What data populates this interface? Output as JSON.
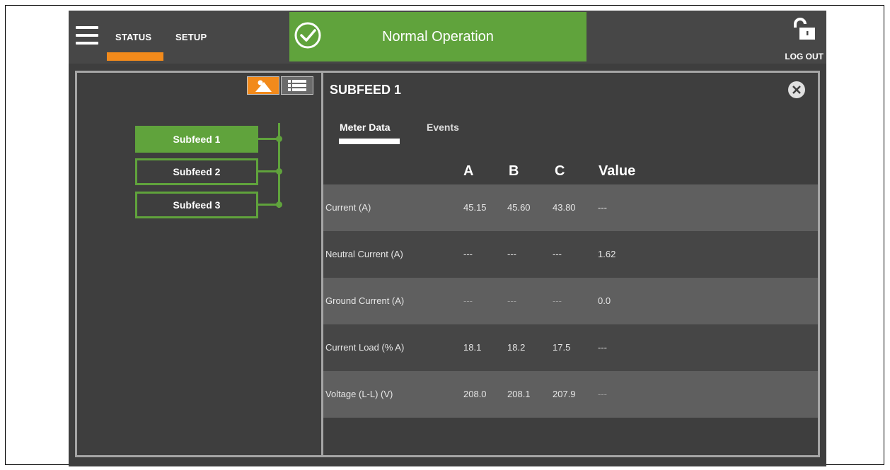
{
  "topbar": {
    "nav": [
      "STATUS",
      "SETUP"
    ],
    "status_text": "Normal Operation",
    "status_icon": "check-circle-icon",
    "logout_label": "LOG OUT",
    "lock_icon": "unlocked-padlock-icon"
  },
  "feeds": [
    "Subfeed 1",
    "Subfeed 2",
    "Subfeed 3"
  ],
  "detail": {
    "title": "SUBFEED 1",
    "tabs": [
      "Meter Data",
      "Events"
    ],
    "columns": [
      "A",
      "B",
      "C",
      "Value"
    ],
    "rows": [
      {
        "label": "Current (A)",
        "a": "45.15",
        "b": "45.60",
        "c": "43.80",
        "value": "---"
      },
      {
        "label": "Neutral Current (A)",
        "a": "---",
        "b": "---",
        "c": "---",
        "value": "1.62"
      },
      {
        "label": "Ground Current (A)",
        "a": "---",
        "b": "---",
        "c": "---",
        "value": "0.0"
      },
      {
        "label": "Current Load (% A)",
        "a": "18.1",
        "b": "18.2",
        "c": "17.5",
        "value": "---"
      },
      {
        "label": "Voltage (L-L) (V)",
        "a": "208.0",
        "b": "208.1",
        "c": "207.9",
        "value": "---"
      }
    ]
  },
  "colors": {
    "accent_green": "#60a33c",
    "accent_orange": "#f28a1b",
    "background": "#3e3e3e"
  }
}
